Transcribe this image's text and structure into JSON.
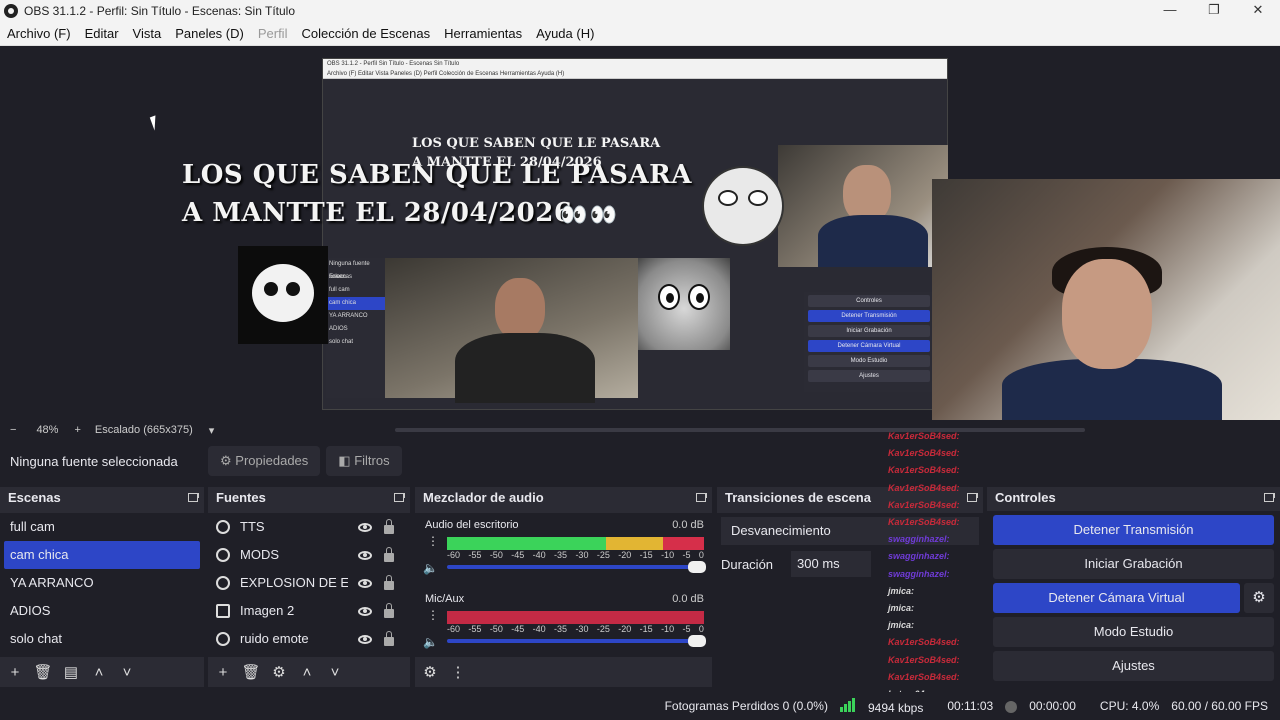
{
  "window": {
    "title": "OBS 31.1.2 - Perfil: Sin Título - Escenas: Sin Título",
    "controls": [
      "—",
      "❐",
      "✕"
    ]
  },
  "menu": {
    "items": [
      {
        "label": "Archivo (F)",
        "disabled": false
      },
      {
        "label": "Editar",
        "disabled": false
      },
      {
        "label": "Vista",
        "disabled": false
      },
      {
        "label": "Paneles (D)",
        "disabled": false
      },
      {
        "label": "Perfil",
        "disabled": true
      },
      {
        "label": "Colección de Escenas",
        "disabled": false
      },
      {
        "label": "Herramientas",
        "disabled": false
      },
      {
        "label": "Ayuda (H)",
        "disabled": false
      }
    ]
  },
  "preview": {
    "overlay_line1": "LOS QUE SABEN QUE LE PASARA",
    "overlay_line2": "A MANTTE EL 28/04/2026",
    "overlay_small1": "LOS QUE SABEN QUE LE PASARA",
    "overlay_small2": "A MANTTE EL 28/04/2026",
    "nested_title": "OBS 31.1.2 - Perfil Sin Título - Escenas Sin Título",
    "nested_menu": "Archivo (F)  Editar  Vista  Paneles (D)  Perfil  Colección de Escenas  Herramientas  Ayuda (H)",
    "nested_scenes": [
      "Ninguna fuente selecc",
      "Escenas",
      "full cam",
      "cam chica",
      "YA ARRANCO",
      "ADIOS",
      "solo chat"
    ],
    "nested_controls": [
      "Controles",
      "Detener Transmisión",
      "Iniciar Grabación",
      "Detener Cámara Virtual",
      "Modo Estudio",
      "Ajustes"
    ],
    "nested_status": "Fotogramas Perdidos 0 (0.0%)",
    "eyes": "👀 👀"
  },
  "zoom": {
    "minus": "−",
    "level": "48%",
    "plus": "+",
    "scale_label": "Escalado (665x375)",
    "dropdown": "▾"
  },
  "source_bar": {
    "no_source": "Ninguna fuente seleccionada",
    "properties": "Propiedades",
    "filters": "Filtros"
  },
  "scenes": {
    "title": "Escenas",
    "items": [
      "full cam",
      "cam chica",
      "YA ARRANCO",
      "ADIOS",
      "solo chat"
    ],
    "selected_index": 1
  },
  "sources": {
    "title": "Fuentes",
    "items": [
      {
        "label": "TTS",
        "icon": "globe"
      },
      {
        "label": "MODS",
        "icon": "globe"
      },
      {
        "label": "EXPLOSION DE EM",
        "icon": "globe"
      },
      {
        "label": "Imagen 2",
        "icon": "image"
      },
      {
        "label": "ruido emote",
        "icon": "globe"
      }
    ]
  },
  "mixer": {
    "title": "Mezclador de audio",
    "channels": [
      {
        "name": "Audio del escritorio",
        "db": "0.0 dB",
        "level": 0.88
      },
      {
        "name": "Mic/Aux",
        "db": "0.0 dB",
        "level": 0.0
      }
    ],
    "scale": [
      "-60",
      "-55",
      "-50",
      "-45",
      "-40",
      "-35",
      "-30",
      "-25",
      "-20",
      "-15",
      "-10",
      "-5",
      "0"
    ]
  },
  "transitions": {
    "title": "Transiciones de escena",
    "selected": "Desvanecimiento",
    "duration_label": "Duración",
    "duration_value": "300 ms"
  },
  "controls": {
    "title": "Controles",
    "stop_stream": "Detener Transmisión",
    "start_recording": "Iniciar Grabación",
    "stop_vcam": "Detener Cámara Virtual",
    "studio_mode": "Modo Estudio",
    "settings": "Ajustes"
  },
  "chat": [
    {
      "user": "Kav1erSoB4sed:",
      "cls": "k"
    },
    {
      "user": "Kav1erSoB4sed:",
      "cls": "k"
    },
    {
      "user": "Kav1erSoB4sed:",
      "cls": "k"
    },
    {
      "user": "Kav1erSoB4sed:",
      "cls": "k"
    },
    {
      "user": "Kav1erSoB4sed:",
      "cls": "k"
    },
    {
      "user": "Kav1erSoB4sed:",
      "cls": "k"
    },
    {
      "user": "swagginhazel:",
      "cls": "s"
    },
    {
      "user": "swagginhazel:",
      "cls": "s"
    },
    {
      "user": "swagginhazel:",
      "cls": "s"
    },
    {
      "user": "jmica:",
      "cls": "j"
    },
    {
      "user": "jmica:",
      "cls": "j"
    },
    {
      "user": "jmica:",
      "cls": "j"
    },
    {
      "user": "Kav1erSoB4sed:",
      "cls": "k"
    },
    {
      "user": "Kav1erSoB4sed:",
      "cls": "k"
    },
    {
      "user": "Kav1erSoB4sed:",
      "cls": "k"
    },
    {
      "user": "kutma04:",
      "cls": "j"
    },
    {
      "user": "kutma04:",
      "cls": "j"
    }
  ],
  "status": {
    "dropped": "Fotogramas Perdidos 0 (0.0%)",
    "bitrate": "9494 kbps",
    "stream_time": "00:11:03",
    "rec_time": "00:00:00",
    "cpu": "CPU: 4.0%",
    "fps": "60.00 / 60.00 FPS"
  },
  "colors": {
    "accent": "#2d46c7",
    "bg": "#1f1f27",
    "panel": "#2b2b34"
  }
}
